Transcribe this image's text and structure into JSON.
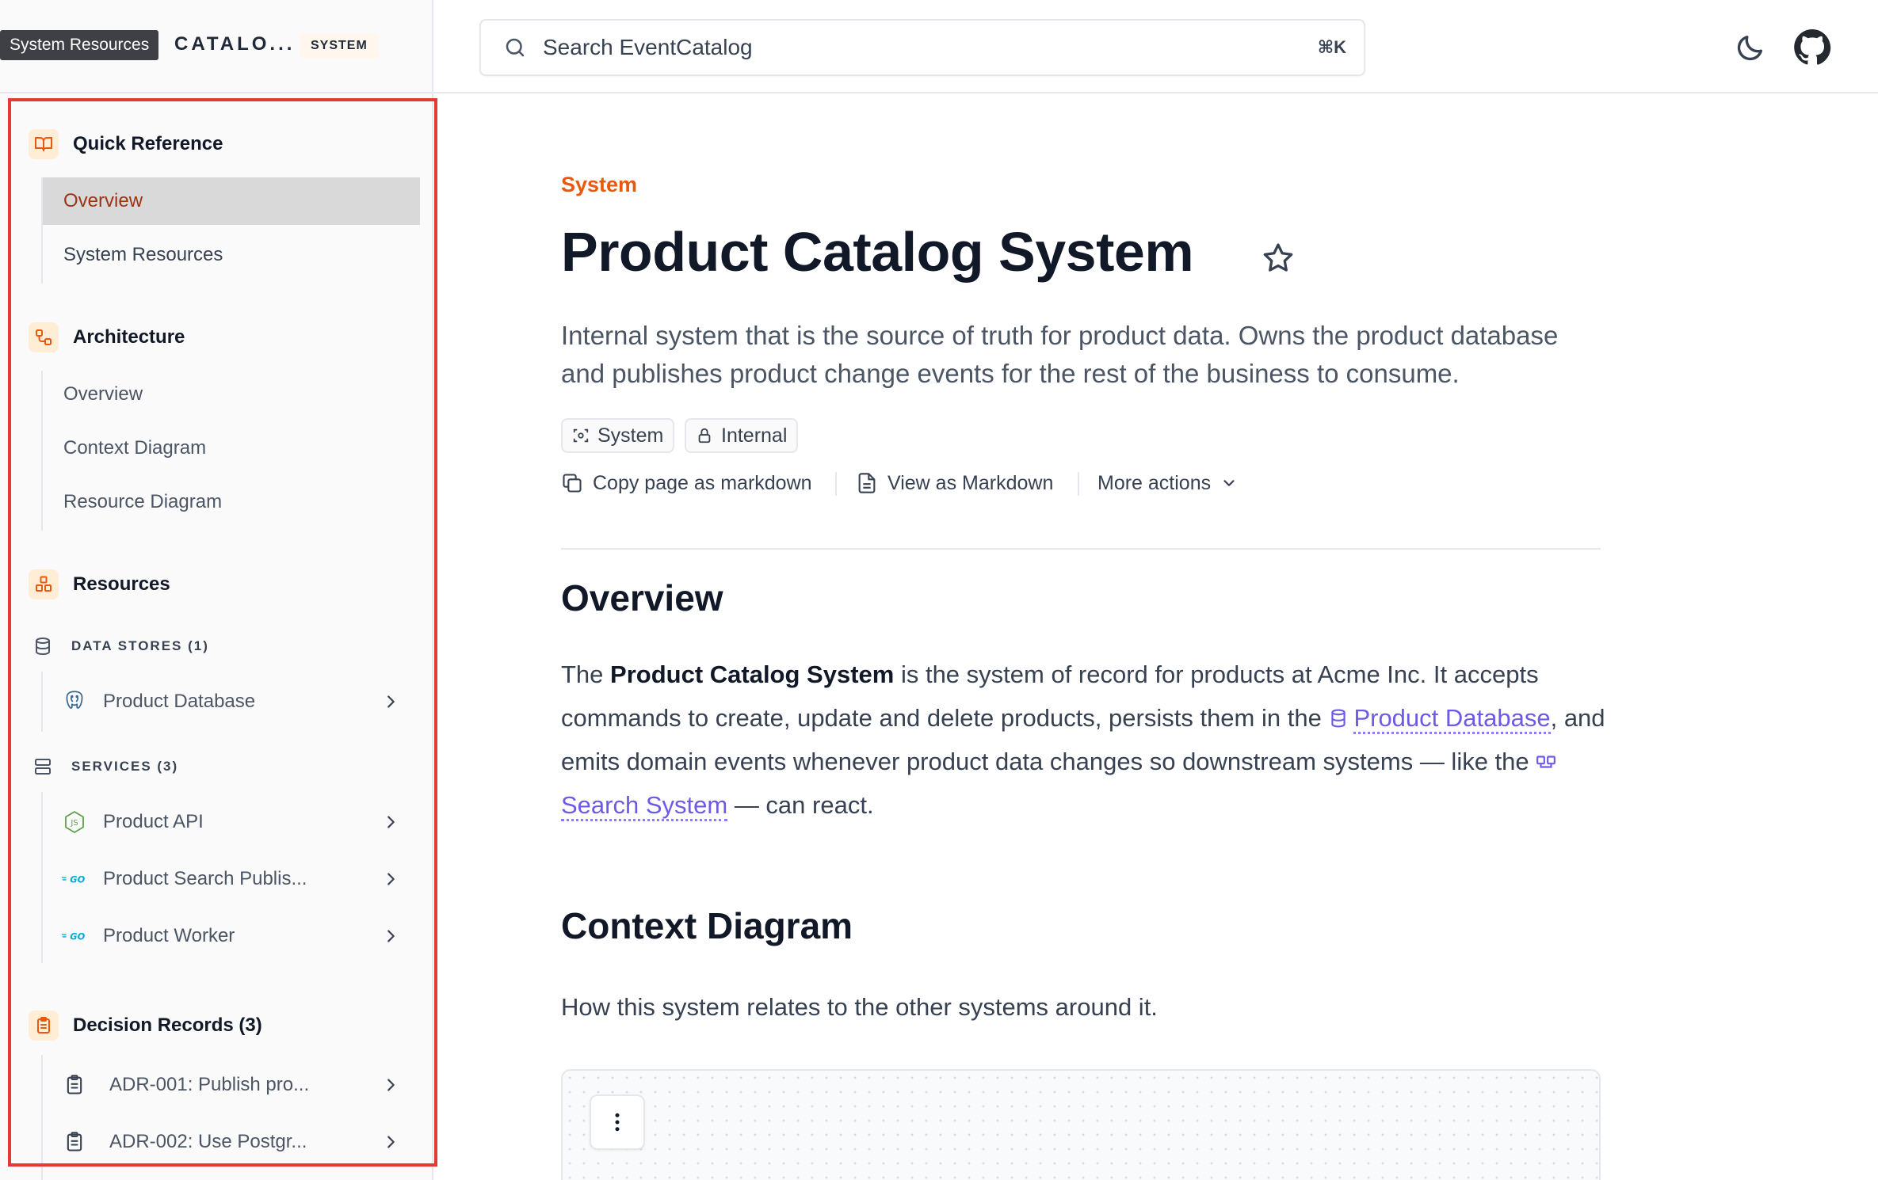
{
  "tooltip": "System Resources",
  "brand": {
    "name": "CATALO...",
    "badge": "SYSTEM"
  },
  "search": {
    "placeholder": "Search EventCatalog",
    "shortcut": "⌘K"
  },
  "sidebar": {
    "quick_reference": {
      "title": "Quick Reference",
      "items": [
        {
          "label": "Overview",
          "active": true
        },
        {
          "label": "System Resources",
          "active": false
        }
      ]
    },
    "architecture": {
      "title": "Architecture",
      "items": [
        {
          "label": "Overview"
        },
        {
          "label": "Context Diagram"
        },
        {
          "label": "Resource Diagram"
        }
      ]
    },
    "resources": {
      "title": "Resources",
      "data_stores": {
        "label": "DATA STORES (1)",
        "items": [
          {
            "label": "Product Database",
            "icon": "postgres-icon"
          }
        ]
      },
      "services": {
        "label": "SERVICES (3)",
        "items": [
          {
            "label": "Product API",
            "icon": "nodejs-icon"
          },
          {
            "label": "Product Search Publis...",
            "icon": "go-icon"
          },
          {
            "label": "Product Worker",
            "icon": "go-icon"
          }
        ]
      }
    },
    "decision_records": {
      "title": "Decision Records (3)",
      "items": [
        {
          "label": "ADR-001: Publish pro..."
        },
        {
          "label": "ADR-002: Use Postgr..."
        }
      ]
    }
  },
  "main": {
    "kicker": "System",
    "title": "Product Catalog System",
    "summary": "Internal system that is the source of truth for product data. Owns the product database and publishes product change events for the rest of the business to consume.",
    "badges": [
      {
        "label": "System"
      },
      {
        "label": "Internal"
      }
    ],
    "actions": {
      "copy": "Copy page as markdown",
      "view": "View as Markdown",
      "more": "More actions"
    },
    "overview": {
      "heading": "Overview",
      "p_before": "The ",
      "p_bold": "Product Catalog System",
      "p_mid1": " is the system of record for products at Acme Inc. It accepts commands to create, update and delete products, persists them in the ",
      "link_database": "Product Database",
      "p_mid2": ", and emits domain events whenever product data changes so downstream systems — like the ",
      "link_search": "Search System",
      "p_end": " — can react."
    },
    "context": {
      "heading": "Context Diagram",
      "body": "How this system relates to the other systems around it."
    }
  },
  "colors": {
    "accent": "#ea580c",
    "link": "#6d5ae6",
    "highlight": "#e53935"
  }
}
